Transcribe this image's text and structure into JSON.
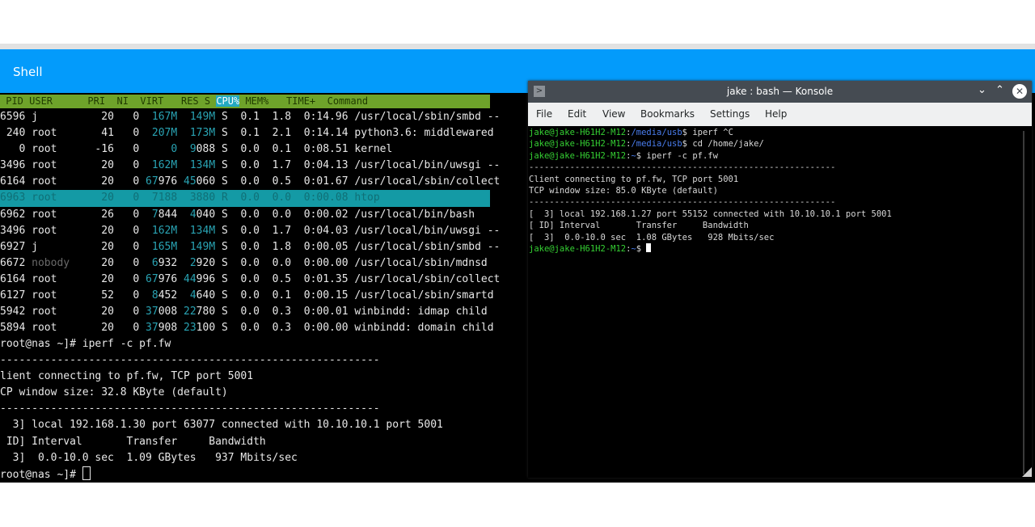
{
  "app": {
    "title": "Shell"
  },
  "htop": {
    "header": {
      "pre": " PID USER      PRI  NI  VIRT   RES S ",
      "cpu": "CPU%",
      "post": " MEM%   TIME+  Command"
    },
    "rows": [
      {
        "pid": "6596",
        "user": "j",
        "pri": "20",
        "ni": "0",
        "virt_a": "",
        "virt_b": "167M",
        "res_a": "",
        "res_b": "149M",
        "s": "S",
        "cpu": "0.1",
        "mem": "1.8",
        "time": "0:14.96",
        "cmd": "/usr/local/sbin/smbd --"
      },
      {
        "pid": "240",
        "user": "root",
        "pri": "41",
        "ni": "0",
        "virt_a": "",
        "virt_b": "207M",
        "res_a": "",
        "res_b": "173M",
        "s": "S",
        "cpu": "0.1",
        "mem": "2.1",
        "time": "0:14.14",
        "cmd": "python3.6: middlewared"
      },
      {
        "pid": "0",
        "user": "root",
        "pri": "-16",
        "ni": "0",
        "virt_a": "0",
        "virt_b": "",
        "res_a": "9",
        "res_b": "088",
        "s": "S",
        "cpu": "0.0",
        "mem": "0.1",
        "time": "0:08.51",
        "cmd": "kernel"
      },
      {
        "pid": "3496",
        "user": "root",
        "pri": "20",
        "ni": "0",
        "virt_a": "",
        "virt_b": "162M",
        "res_a": "",
        "res_b": "134M",
        "s": "S",
        "cpu": "0.0",
        "mem": "1.7",
        "time": "0:04.13",
        "cmd": "/usr/local/bin/uwsgi --"
      },
      {
        "pid": "6164",
        "user": "root",
        "pri": "20",
        "ni": "0",
        "virt_a": "67",
        "virt_b": "976",
        "res_a": "45",
        "res_b": "060",
        "s": "S",
        "cpu": "0.0",
        "mem": "0.5",
        "time": "0:01.67",
        "cmd": "/usr/local/sbin/collect"
      },
      {
        "pid": "6963",
        "user": "root",
        "pri": "20",
        "ni": "0",
        "virt_a": "7188",
        "virt_b": "",
        "res_a": "3880",
        "res_b": "",
        "s": "R",
        "cpu": "0.0",
        "mem": "0.0",
        "time": "0:00.08",
        "cmd": "htop",
        "selected": true
      },
      {
        "pid": "6962",
        "user": "root",
        "pri": "26",
        "ni": "0",
        "virt_a": "7",
        "virt_b": "844",
        "res_a": "4",
        "res_b": "040",
        "s": "S",
        "cpu": "0.0",
        "mem": "0.0",
        "time": "0:00.02",
        "cmd": "/usr/local/bin/bash"
      },
      {
        "pid": "3496",
        "user": "root",
        "pri": "20",
        "ni": "0",
        "virt_a": "",
        "virt_b": "162M",
        "res_a": "",
        "res_b": "134M",
        "s": "S",
        "cpu": "0.0",
        "mem": "1.7",
        "time": "0:04.03",
        "cmd": "/usr/local/bin/uwsgi --"
      },
      {
        "pid": "6927",
        "user": "j",
        "pri": "20",
        "ni": "0",
        "virt_a": "",
        "virt_b": "165M",
        "res_a": "",
        "res_b": "149M",
        "s": "S",
        "cpu": "0.0",
        "mem": "1.8",
        "time": "0:00.05",
        "cmd": "/usr/local/sbin/smbd --"
      },
      {
        "pid": "6672",
        "user": "nobody",
        "pri": "20",
        "ni": "0",
        "virt_a": "6",
        "virt_b": "932",
        "res_a": "2",
        "res_b": "920",
        "s": "S",
        "cpu": "0.0",
        "mem": "0.0",
        "time": "0:00.00",
        "cmd": "/usr/local/sbin/mdnsd",
        "dimUser": true
      },
      {
        "pid": "6164",
        "user": "root",
        "pri": "20",
        "ni": "0",
        "virt_a": "67",
        "virt_b": "976",
        "res_a": "44",
        "res_b": "996",
        "s": "S",
        "cpu": "0.0",
        "mem": "0.5",
        "time": "0:01.35",
        "cmd": "/usr/local/sbin/collect"
      },
      {
        "pid": "6127",
        "user": "root",
        "pri": "52",
        "ni": "0",
        "virt_a": "8",
        "virt_b": "452",
        "res_a": "4",
        "res_b": "640",
        "s": "S",
        "cpu": "0.0",
        "mem": "0.1",
        "time": "0:00.15",
        "cmd": "/usr/local/sbin/smartd"
      },
      {
        "pid": "5942",
        "user": "root",
        "pri": "20",
        "ni": "0",
        "virt_a": "37",
        "virt_b": "008",
        "res_a": "22",
        "res_b": "780",
        "s": "S",
        "cpu": "0.0",
        "mem": "0.3",
        "time": "0:00.01",
        "cmd": "winbindd: idmap child"
      },
      {
        "pid": "5894",
        "user": "root",
        "pri": "20",
        "ni": "0",
        "virt_a": "37",
        "virt_b": "908",
        "res_a": "23",
        "res_b": "100",
        "s": "S",
        "cpu": "0.0",
        "mem": "0.3",
        "time": "0:00.00",
        "cmd": "winbindd: domain child"
      }
    ]
  },
  "left_output": [
    "root@nas ~]# iperf -c pf.fw",
    "------------------------------------------------------------",
    "lient connecting to pf.fw, TCP port 5001",
    "CP window size: 32.8 KByte (default)",
    "------------------------------------------------------------",
    "  3] local 192.168.1.30 port 63077 connected with 10.10.10.1 port 5001",
    " ID] Interval       Transfer     Bandwidth",
    "  3]  0.0-10.0 sec  1.09 GBytes   937 Mbits/sec"
  ],
  "left_prompt": "root@nas ~]# ",
  "konsole": {
    "title": "jake : bash — Konsole",
    "menu": [
      "File",
      "Edit",
      "View",
      "Bookmarks",
      "Settings",
      "Help"
    ],
    "cmd_lines": [
      {
        "user": "jake@jake-H61H2-M12",
        "path": "/media/usb",
        "cmd": "iperf ^C"
      },
      {
        "user": "jake@jake-H61H2-M12",
        "path": "/media/usb",
        "cmd": "cd /home/jake/"
      },
      {
        "user": "jake@jake-H61H2-M12",
        "path": "~",
        "cmd": "iperf -c pf.fw"
      }
    ],
    "output": [
      "------------------------------------------------------------",
      "Client connecting to pf.fw, TCP port 5001",
      "TCP window size: 85.0 KByte (default)",
      "------------------------------------------------------------",
      "[  3] local 192.168.1.27 port 55152 connected with 10.10.10.1 port 5001",
      "[ ID] Interval       Transfer     Bandwidth",
      "[  3]  0.0-10.0 sec  1.08 GBytes   928 Mbits/sec"
    ],
    "prompt": {
      "user": "jake@jake-H61H2-M12",
      "path": "~"
    }
  },
  "colors": {
    "header": "#039bfb",
    "htop_header": "#6ea32a",
    "htop_cpu": "#23a9c1",
    "selected_row": "#149aa5",
    "prompt_green": "#35d033",
    "path_blue": "#4a7ef0"
  }
}
